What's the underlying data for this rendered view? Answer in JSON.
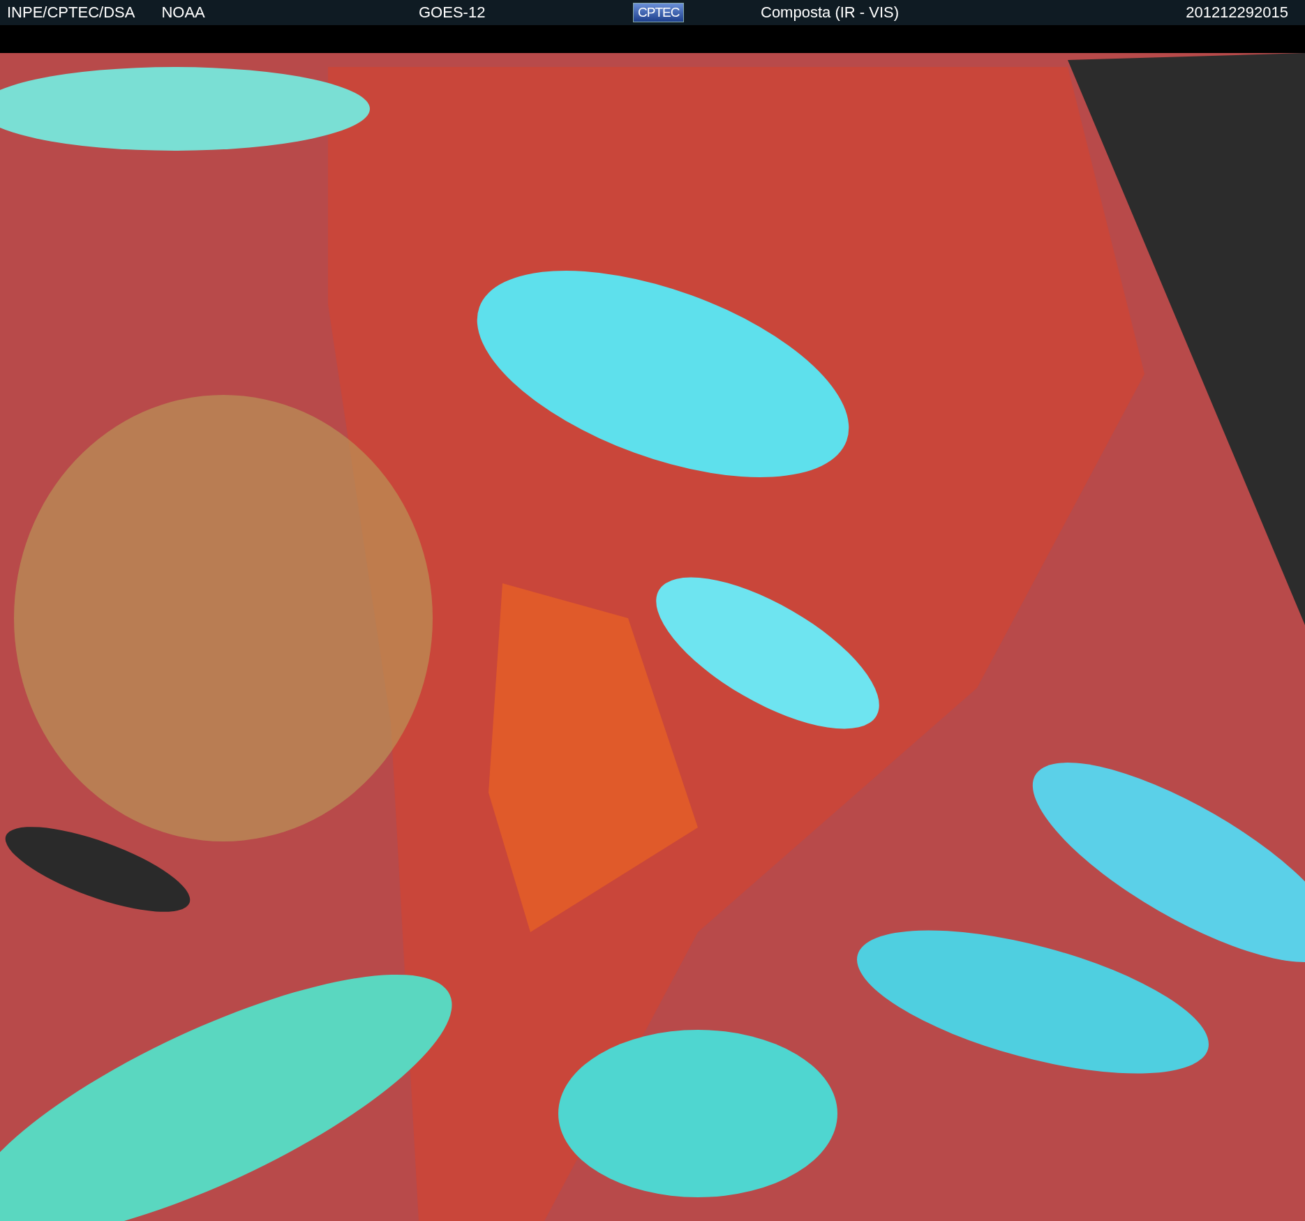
{
  "header": {
    "left": [
      "INPE/CPTEC/DSA",
      "NOAA"
    ],
    "satellite": "GOES-12",
    "logo": "CPTEC",
    "product": "Composta (IR - VIS)",
    "timestamp": "201212292015"
  }
}
